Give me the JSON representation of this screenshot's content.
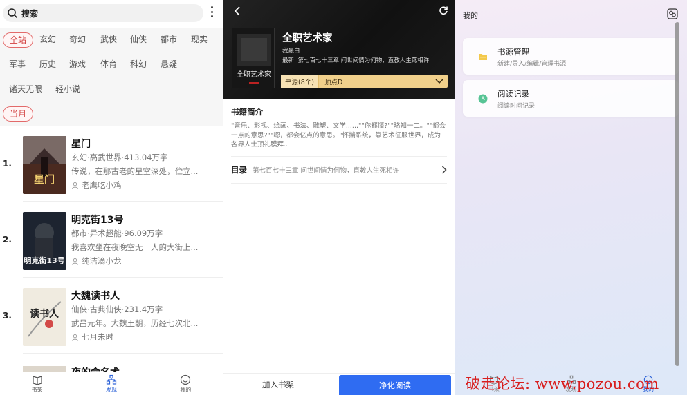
{
  "left": {
    "search_placeholder": "搜索",
    "categories": [
      "全站",
      "玄幻",
      "奇幻",
      "武侠",
      "仙侠",
      "都市",
      "现实",
      "军事",
      "历史",
      "游戏",
      "体育",
      "科幻",
      "悬疑",
      "诸天无限",
      "轻小说"
    ],
    "period": "当月",
    "books": [
      {
        "rank": "1.",
        "title": "星门",
        "meta": "玄幻·高武世界·413.04万字",
        "desc": "传说，在那古老的星空深处，伫立...",
        "author": "老鹰吃小鸡",
        "cover_text": "星门"
      },
      {
        "rank": "2.",
        "title": "明克街13号",
        "meta": "都市·异术超能·96.09万字",
        "desc": "我喜欢坐在夜晚空无一人的大街上...",
        "author": "纯洁滴小龙",
        "cover_text": "明克街13号"
      },
      {
        "rank": "3.",
        "title": "大魏读书人",
        "meta": "仙侠·古典仙侠·231.4万字",
        "desc": "武昌元年。大魏王朝，历经七次北...",
        "author": "七月未时",
        "cover_text": "读书人"
      }
    ],
    "partial_book_title": "夜的命名术",
    "nav": [
      {
        "label": "书架",
        "icon": "bookshelf-icon"
      },
      {
        "label": "发现",
        "icon": "discover-icon"
      },
      {
        "label": "我的",
        "icon": "profile-icon"
      }
    ]
  },
  "middle": {
    "title": "全职艺术家",
    "author": "我最白",
    "latest": "最新: 第七百七十三章 问世间情为何物，直教人生死相许",
    "cover_text": "全职艺术家",
    "source_label": "书源(8个)",
    "source_value": "顶点D",
    "intro_heading": "书籍简介",
    "intro_body": "\"音乐、影视、绘画、书法、雕塑、文学......\"\"你都懂?\"\"略知一二。\"\"都会一点的意思?\"\"嗯，都会亿点的意思。\"怀揣系统，靠艺术征服世界，成为各界人士顶礼膜拜..",
    "toc_label": "目录",
    "toc_value": "第七百七十三章 问世间情为何物，直教人生死相许",
    "add_shelf": "加入书架",
    "clean_read": "净化阅读"
  },
  "right": {
    "title": "我的",
    "cards": [
      {
        "title": "书源管理",
        "subtitle": "新建/导入/编辑/管理书源",
        "icon": "folder-icon",
        "color": "#f3c94c"
      },
      {
        "title": "阅读记录",
        "subtitle": "阅读时间记录",
        "icon": "clock-icon",
        "color": "#57c495"
      }
    ],
    "nav": [
      "书架",
      "发现",
      "我的"
    ]
  },
  "watermark": "破走论坛: www.pozou.com",
  "colors": {
    "accent": "#2f6cf2",
    "pill": "#d24040",
    "source_bar": "#f1d08b"
  }
}
